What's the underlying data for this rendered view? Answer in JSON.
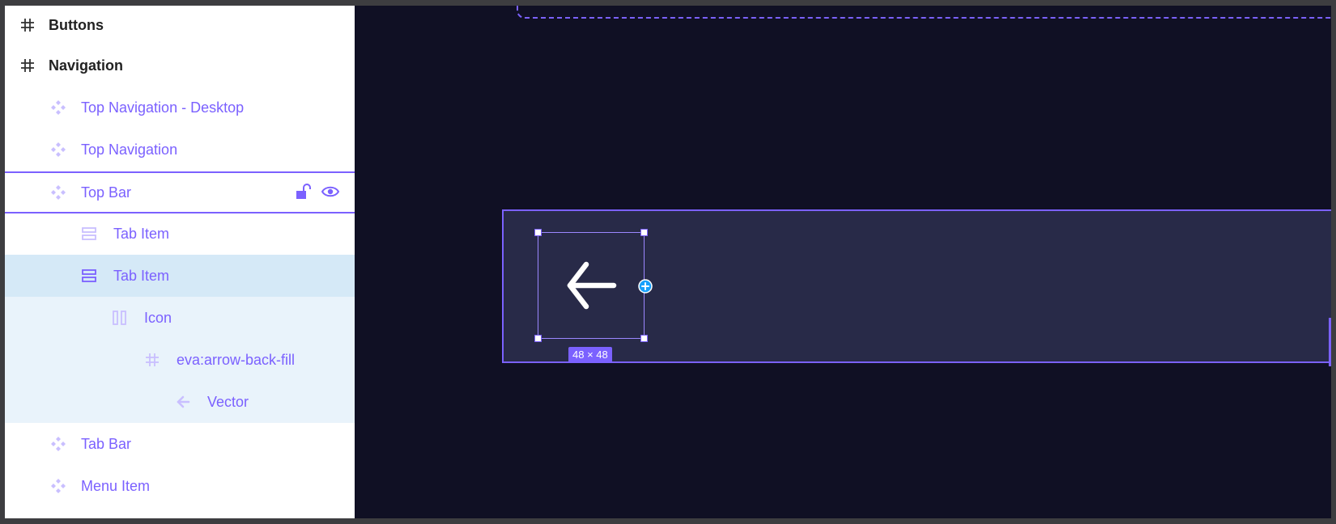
{
  "layers": {
    "items": [
      {
        "label": "Buttons",
        "kind": "frame",
        "icon": "hash-icon"
      },
      {
        "label": "Navigation",
        "kind": "frame",
        "icon": "hash-icon"
      },
      {
        "label": "Top Navigation - Desktop",
        "kind": "component",
        "icon": "component-icon"
      },
      {
        "label": "Top Navigation",
        "kind": "component",
        "icon": "component-icon"
      },
      {
        "label": "Top Bar",
        "kind": "component",
        "icon": "component-icon",
        "hovered": true
      },
      {
        "label": "Tab Item",
        "kind": "autolayout-vertical",
        "icon": "vertical-layout-icon"
      },
      {
        "label": "Tab Item",
        "kind": "autolayout-vertical",
        "icon": "vertical-layout-icon",
        "selected": true
      },
      {
        "label": "Icon",
        "kind": "autolayout-horizontal",
        "icon": "horizontal-layout-icon"
      },
      {
        "label": "eva:arrow-back-fill",
        "kind": "frame",
        "icon": "hash-icon"
      },
      {
        "label": "Vector",
        "kind": "vector",
        "icon": "arrow-left-icon"
      },
      {
        "label": "Tab Bar",
        "kind": "component",
        "icon": "component-icon"
      },
      {
        "label": "Menu Item",
        "kind": "component",
        "icon": "component-icon"
      }
    ]
  },
  "canvas": {
    "selection_size_label": "48 × 48"
  },
  "colors": {
    "accent": "#7b61ff",
    "canvas_bg": "#101024",
    "frame_fill": "#282a48",
    "selected_row": "#d5e9f7",
    "child_row": "#e9f3fb",
    "add_handle": "#18a0fb"
  }
}
